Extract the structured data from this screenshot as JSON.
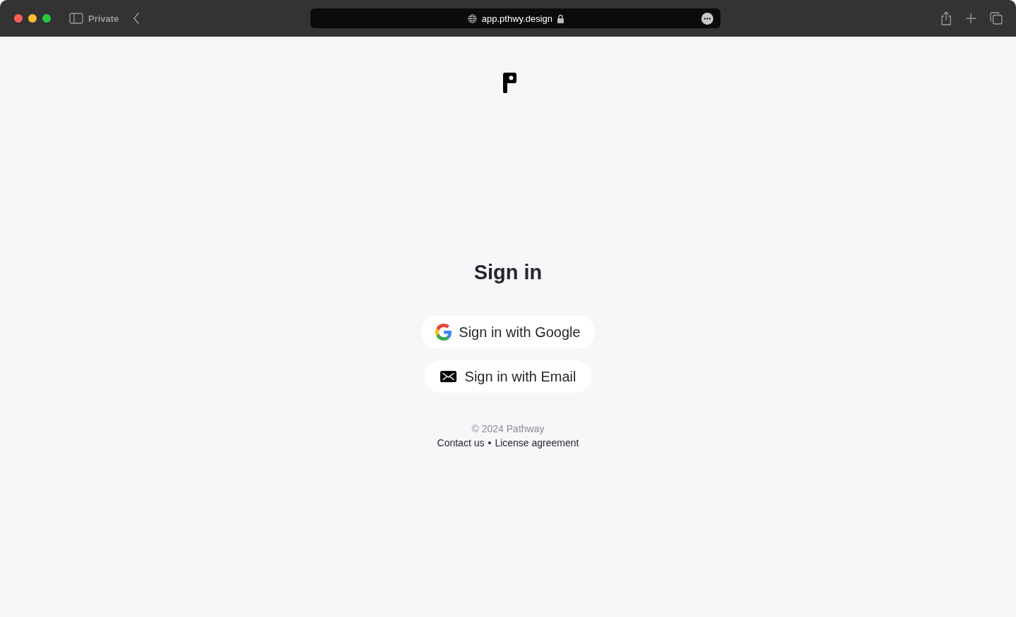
{
  "browser": {
    "private_label": "Private",
    "url": "app.pthwy.design"
  },
  "title": "Sign in",
  "buttons": [
    {
      "kind": "google",
      "label": "Sign in with Google"
    },
    {
      "kind": "email",
      "label": "Sign in with Email"
    }
  ],
  "footer": {
    "copyright": "© 2024 Pathway",
    "links": [
      "Contact us",
      "License agreement"
    ],
    "separator": "•"
  }
}
